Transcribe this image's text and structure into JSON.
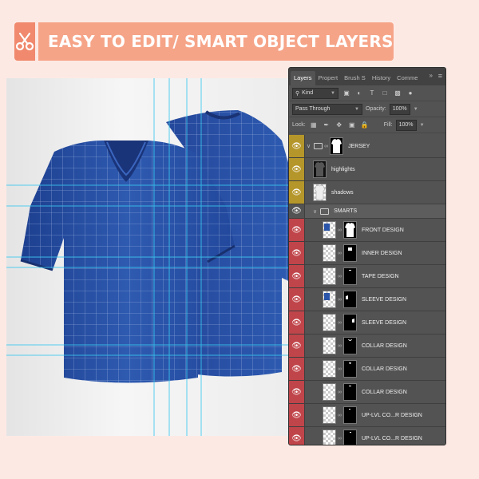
{
  "banner": {
    "icon": "scissors-icon",
    "text": "EASY TO EDIT/ SMART OBJECT LAYERS",
    "icon_bg": "#f0896d",
    "text_bg": "#f6a488"
  },
  "panel": {
    "tabs": [
      "Layers",
      "Propert",
      "Brush S",
      "History",
      "Comme"
    ],
    "active_tab": "Layers",
    "filter": {
      "value": "Kind"
    },
    "blend_mode": "Pass Through",
    "opacity_label": "Opacity:",
    "opacity": "100%",
    "lock_label": "Lock:",
    "fill_label": "Fill:",
    "fill": "100%"
  },
  "layers": [
    {
      "name": "JERSEY",
      "kind": "group",
      "color": "yellow"
    },
    {
      "name": "highlights",
      "kind": "layer",
      "color": "yellow"
    },
    {
      "name": "shadows",
      "kind": "layer",
      "color": "yellow"
    },
    {
      "name": "SMARTS",
      "kind": "subgroup",
      "color": "none"
    },
    {
      "name": "FRONT DESIGN",
      "kind": "smart",
      "color": "red"
    },
    {
      "name": "INNER DESIGN",
      "kind": "smart",
      "color": "red"
    },
    {
      "name": "TAPE DESIGN",
      "kind": "smart",
      "color": "red"
    },
    {
      "name": "SLEEVE DESIGN",
      "kind": "smart",
      "color": "red"
    },
    {
      "name": "SLEEVE DESIGN",
      "kind": "smart",
      "color": "red"
    },
    {
      "name": "COLLAR DESIGN",
      "kind": "smart",
      "color": "red"
    },
    {
      "name": "COLLAR DESIGN",
      "kind": "smart",
      "color": "red"
    },
    {
      "name": "COLLAR DESIGN",
      "kind": "smart",
      "color": "red"
    },
    {
      "name": "UP-LVL CO...R DESIGN",
      "kind": "smart",
      "color": "red"
    },
    {
      "name": "UP-LVL CO...R DESIGN",
      "kind": "smart",
      "color": "red"
    }
  ],
  "colors": {
    "shirt": "#2b57a8",
    "guide": "#39c8f0",
    "yellow_label": "#b5962a",
    "red_label": "#c0454a"
  }
}
